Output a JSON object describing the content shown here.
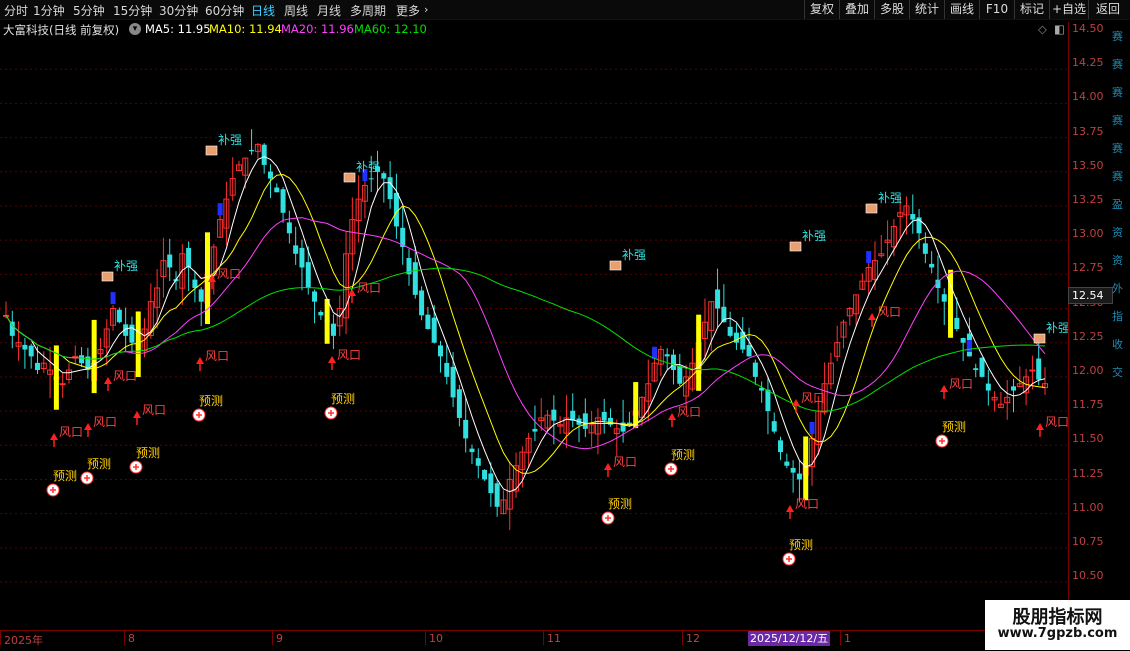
{
  "toolbar": {
    "periods": [
      "分时",
      "1分钟",
      "5分钟",
      "15分钟",
      "30分钟",
      "60分钟",
      "日线",
      "周线",
      "月线",
      "多周期",
      "更多"
    ],
    "active_period": "日线",
    "more_icon": "chevron-right-icon",
    "right_buttons": [
      "复权",
      "叠加",
      "多股",
      "统计",
      "画线",
      "F10",
      "标记",
      "+自选",
      "返回"
    ]
  },
  "info": {
    "title": "大富科技(日线 前复权)",
    "settings_icon": "gear-circle-icon",
    "ma5": "MA5: 11.95",
    "ma10": "MA10: 11.94",
    "ma20": "MA20: 11.96",
    "ma60": "MA60: 12.10",
    "colors": {
      "ma5": "#ffffff",
      "ma10": "#ffff00",
      "ma20": "#ff40ff",
      "ma60": "#00e000"
    }
  },
  "yaxis": {
    "ticks": [
      "14.50",
      "14.25",
      "14.00",
      "13.75",
      "13.50",
      "13.25",
      "13.00",
      "12.75",
      "12.50",
      "12.25",
      "12.00",
      "11.75",
      "11.50",
      "11.25",
      "11.00",
      "10.75",
      "10.50"
    ],
    "current_price": "12.54"
  },
  "xaxis": {
    "labels": [
      "2025年",
      "8",
      "9",
      "10",
      "11",
      "12",
      "1"
    ],
    "cursor_date": "2025/12/12/五"
  },
  "right_strip": [
    "赛",
    "赛",
    "赛",
    "赛",
    "赛",
    "赛",
    "盈",
    "资",
    "资",
    "外",
    "指",
    "收",
    "交"
  ],
  "signals": {
    "buqiang": "补强",
    "fengkou": "风口",
    "yuce": "预测"
  },
  "watermark": {
    "line1": "股朋指标网",
    "line2": "www.7gpzb.com"
  },
  "chart_data": {
    "type": "candlestick",
    "yrange": [
      10.4,
      14.6
    ],
    "ma_labels": [
      "MA5",
      "MA10",
      "MA20",
      "MA60"
    ],
    "close": [
      12.45,
      12.3,
      12.25,
      12.2,
      12.15,
      12.05,
      12.1,
      12.05,
      12.0,
      11.95,
      12.05,
      12.15,
      12.1,
      12.05,
      12.1,
      12.2,
      12.35,
      12.5,
      12.4,
      12.3,
      12.25,
      12.2,
      12.35,
      12.55,
      12.65,
      12.85,
      12.8,
      12.7,
      12.9,
      12.8,
      12.65,
      12.55,
      12.75,
      12.95,
      13.15,
      13.3,
      13.45,
      13.55,
      13.6,
      13.65,
      13.7,
      13.55,
      13.45,
      13.35,
      13.2,
      13.05,
      12.9,
      12.8,
      12.65,
      12.55,
      12.45,
      12.4,
      12.3,
      12.5,
      12.9,
      13.15,
      13.3,
      13.4,
      13.45,
      13.5,
      13.45,
      13.3,
      13.1,
      12.95,
      12.75,
      12.6,
      12.45,
      12.35,
      12.25,
      12.15,
      12.0,
      11.85,
      11.7,
      11.55,
      11.45,
      11.35,
      11.25,
      11.15,
      11.05,
      11.1,
      11.25,
      11.35,
      11.45,
      11.55,
      11.6,
      11.7,
      11.72,
      11.68,
      11.65,
      11.7,
      11.68,
      11.65,
      11.62,
      11.65,
      11.7,
      11.68,
      11.65,
      11.62,
      11.6,
      11.65,
      11.75,
      11.85,
      11.95,
      12.1,
      12.2,
      12.15,
      12.05,
      11.95,
      12.0,
      12.1,
      12.25,
      12.4,
      12.55,
      12.5,
      12.4,
      12.3,
      12.25,
      12.2,
      12.15,
      12.0,
      11.9,
      11.75,
      11.6,
      11.45,
      11.35,
      11.3,
      11.25,
      11.35,
      11.55,
      11.75,
      11.95,
      12.1,
      12.25,
      12.4,
      12.5,
      12.6,
      12.7,
      12.8,
      12.85,
      12.9,
      13.0,
      13.1,
      13.2,
      13.25,
      13.15,
      13.05,
      12.9,
      12.8,
      12.65,
      12.55,
      12.45,
      12.35,
      12.25,
      12.15,
      12.05,
      12.0,
      11.9,
      11.85,
      11.8,
      11.85,
      11.9,
      11.95,
      12.0,
      12.05,
      11.98,
      11.95
    ]
  }
}
